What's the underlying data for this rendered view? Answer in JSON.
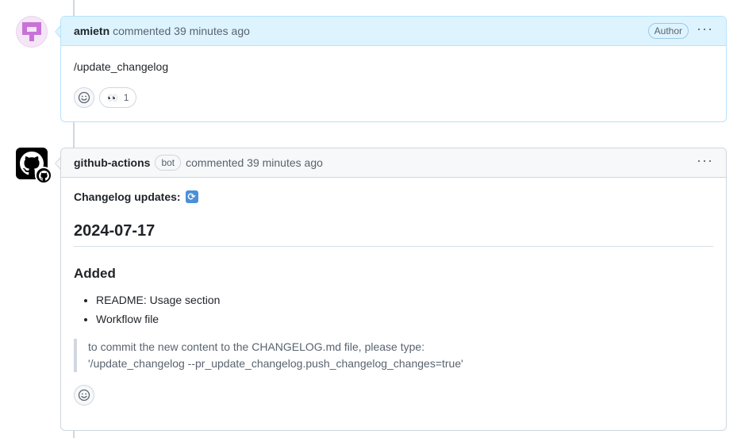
{
  "comments": [
    {
      "author": "amietn",
      "meta": "commented 39 minutes ago",
      "author_label": "Author",
      "more_icon": "kebab-horizontal-icon",
      "body": "/update_changelog",
      "reactions": [
        {
          "emoji": "👀",
          "count": "1"
        }
      ]
    },
    {
      "author": "github-actions",
      "bot_label": "bot",
      "meta": "commented 39 minutes ago",
      "more_icon": "kebab-horizontal-icon",
      "changelog_title": "Changelog updates:",
      "date_heading": "2024-07-17",
      "section_heading": "Added",
      "items": [
        "README: Usage section",
        "Workflow file"
      ],
      "quote_line1": "to commit the new content to the CHANGELOG.md file, please type:",
      "quote_line2": "'/update_changelog --pr_update_changelog.push_changelog_changes=true'"
    }
  ],
  "colors": {
    "author_header_bg": "#ddf4ff",
    "author_border": "#b6e3ff",
    "default_header_bg": "#f6f8fa",
    "border": "#d0d7de",
    "identicon": "#c872d8"
  }
}
